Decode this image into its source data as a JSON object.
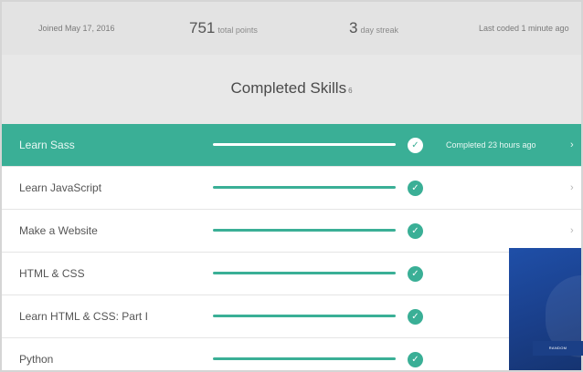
{
  "stats": {
    "joined": "Joined May 17, 2016",
    "points_value": "751",
    "points_label": "total points",
    "streak_value": "3",
    "streak_label": "day streak",
    "last_coded": "Last coded 1 minute ago"
  },
  "header": {
    "title": "Completed Skills",
    "count": "6"
  },
  "skills": [
    {
      "name": "Learn Sass",
      "progress": 1.0,
      "completed": true,
      "status": "Completed 23 hours ago",
      "chevron": "›",
      "selected": true
    },
    {
      "name": "Learn JavaScript",
      "progress": 1.0,
      "completed": true,
      "status": "",
      "chevron": "›",
      "selected": false
    },
    {
      "name": "Make a Website",
      "progress": 1.0,
      "completed": true,
      "status": "",
      "chevron": "›",
      "selected": false
    },
    {
      "name": "HTML & CSS",
      "progress": 1.0,
      "completed": true,
      "status": "",
      "chevron": "",
      "selected": false
    },
    {
      "name": "Learn HTML & CSS: Part I",
      "progress": 1.0,
      "completed": true,
      "status": "",
      "chevron": "",
      "selected": false
    },
    {
      "name": "Python",
      "progress": 1.0,
      "completed": true,
      "status": "",
      "chevron": "",
      "selected": false
    }
  ],
  "promo": {
    "label": "RANDOM"
  },
  "icons": {
    "check": "check-circle-icon",
    "chevron": "chevron-right-icon"
  },
  "colors": {
    "accent": "#3aaf96",
    "stats_bg": "#e3e3e3",
    "header_bg": "#e8e8e8",
    "promo_bg": "#1f4fa8"
  }
}
